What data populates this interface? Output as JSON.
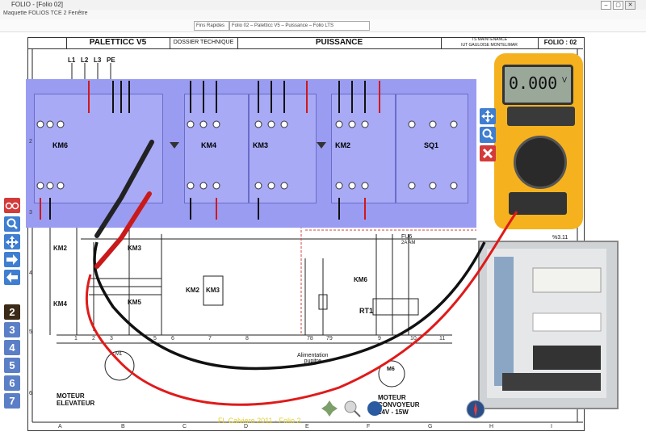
{
  "window": {
    "title": "FOLIO - [Folio 02]",
    "controls": [
      "–",
      "▢",
      "✕"
    ]
  },
  "menubar": {
    "text": "Maquette FOLIOS TCE  2   Fenêtre"
  },
  "toolbar": {
    "field_a": "Fins Rapides",
    "field_b": "Folio 02 – Paletticc V5 – Puissance – Folio LTS"
  },
  "title_block": {
    "project": "PALETTICC V5",
    "doc_type": "DOSSIER TECHNIQUE",
    "section": "PUISSANCE",
    "school_line1": "TS MAINTENANCE",
    "school_line2": "IUT GAULOISE MONTELIMAR",
    "folio": "FOLIO : 02"
  },
  "supply_labels": [
    "L1",
    "L2",
    "L3",
    "PE"
  ],
  "relays": [
    {
      "name": "KM6"
    },
    {
      "name": "KM4"
    },
    {
      "name": "KM3"
    },
    {
      "name": "KM2"
    },
    {
      "name": "SQ1"
    }
  ],
  "schematic": {
    "left_contactors": [
      "KM2",
      "KM3",
      "KM4",
      "KM5"
    ],
    "mid_contactors": [
      "KM2",
      "KM3"
    ],
    "km6_label": "KM6",
    "rt1_label": "RT1",
    "fu6_label": "FU6",
    "fu6_rating": "2A AM",
    "power_supply": "Alimentation pupitre",
    "power_supply_label1": "Alimentation",
    "power_supply_label2": "pupitre",
    "motor1_line1": "MOTEUR",
    "motor1_line2": "ELEVATEUR",
    "motor1_sym": "M1",
    "motor2_line1": "MOTEUR",
    "motor2_line2": "CONVOYEUR",
    "motor2_spec": "24V - 15W",
    "motor2_sym": "M6",
    "fuse_ref": "%3.11",
    "row_numbers": [
      "1",
      "2",
      "3",
      "4",
      "5",
      "6",
      "7"
    ],
    "column_letters": [
      "A",
      "B",
      "C",
      "D",
      "E",
      "F",
      "G",
      "H",
      "I",
      "J"
    ],
    "bus_numbers": [
      "1",
      "2",
      "3",
      "4",
      "5",
      "6",
      "7",
      "8",
      "78",
      "79",
      "9",
      "10",
      "11"
    ],
    "footer_text": "FL Calviere 2011 - Folio 2"
  },
  "multimeter": {
    "display": "0.000",
    "unit": "V"
  },
  "tools": {
    "glasses": "glasses-icon",
    "zoom": "zoom-icon",
    "move": "move-icon",
    "next": "arrow-right-icon",
    "prev": "arrow-left-icon"
  },
  "folio_numbers": [
    "2",
    "3",
    "4",
    "5",
    "6",
    "7"
  ],
  "colors": {
    "relay_panel": "#9a9cf2",
    "red_lead": "#e01a1a",
    "black_lead": "#111111",
    "tool_red": "#d33a3a",
    "tool_blue": "#3f7ed0",
    "folio_selected": "#3b2a17",
    "folio_blue": "#5b7fc6"
  }
}
